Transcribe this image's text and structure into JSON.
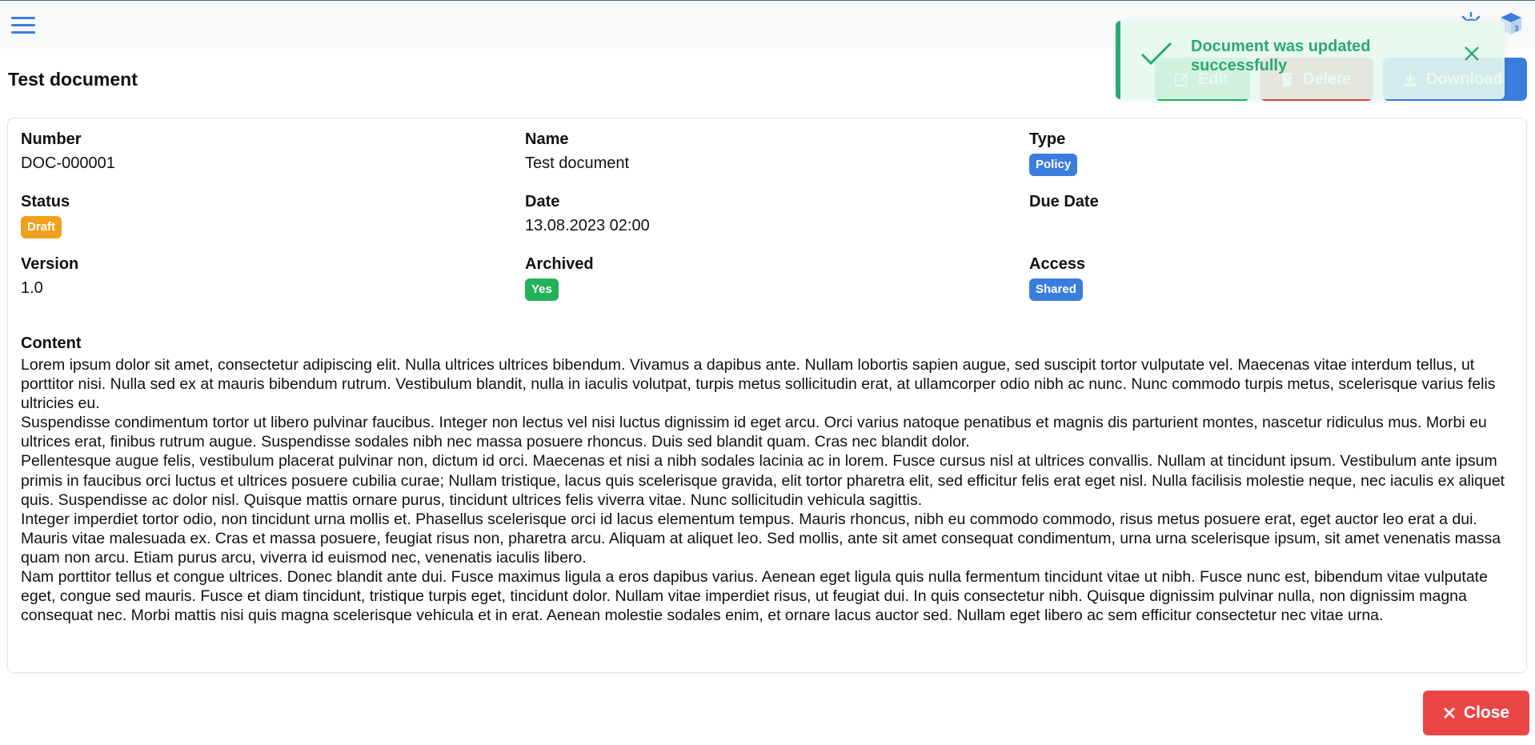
{
  "header": {
    "menu_icon": "hamburger-icon",
    "theme_icon": "sun-icon",
    "app_icon": "cube-icon"
  },
  "page": {
    "title": "Test document"
  },
  "actions": {
    "edit_label": "Edit",
    "delete_label": "Delete",
    "download_label": "Download"
  },
  "toast": {
    "message": "Document was updated successfully",
    "type": "success",
    "color": "#2aa876"
  },
  "fields": {
    "number": {
      "label": "Number",
      "value": "DOC-000001"
    },
    "name": {
      "label": "Name",
      "value": "Test document"
    },
    "type": {
      "label": "Type",
      "value": "Policy",
      "color": "#3b7ddd"
    },
    "status": {
      "label": "Status",
      "value": "Draft",
      "color": "#f0a01e"
    },
    "date": {
      "label": "Date",
      "value": "13.08.2023 02:00"
    },
    "due_date": {
      "label": "Due Date",
      "value": ""
    },
    "version": {
      "label": "Version",
      "value": "1.0"
    },
    "archived": {
      "label": "Archived",
      "value": "Yes",
      "color": "#22b35a"
    },
    "access": {
      "label": "Access",
      "value": "Shared",
      "color": "#3b7ddd"
    }
  },
  "content": {
    "label": "Content",
    "paragraphs": [
      "Lorem ipsum dolor sit amet, consectetur adipiscing elit. Nulla ultrices ultrices bibendum. Vivamus a dapibus ante. Nullam lobortis sapien augue, sed suscipit tortor vulputate vel. Maecenas vitae interdum tellus, ut porttitor nisi. Nulla sed ex at mauris bibendum rutrum. Vestibulum blandit, nulla in iaculis volutpat, turpis metus sollicitudin erat, at ullamcorper odio nibh ac nunc. Nunc commodo turpis metus, scelerisque varius felis ultricies eu.",
      "Suspendisse condimentum tortor ut libero pulvinar faucibus. Integer non lectus vel nisi luctus dignissim id eget arcu. Orci varius natoque penatibus et magnis dis parturient montes, nascetur ridiculus mus. Morbi eu ultrices erat, finibus rutrum augue. Suspendisse sodales nibh nec massa posuere rhoncus. Duis sed blandit quam. Cras nec blandit dolor.",
      "Pellentesque augue felis, vestibulum placerat pulvinar non, dictum id orci. Maecenas et nisi a nibh sodales lacinia ac in lorem. Fusce cursus nisl at ultrices convallis. Nullam at tincidunt ipsum. Vestibulum ante ipsum primis in faucibus orci luctus et ultrices posuere cubilia curae; Nullam tristique, lacus quis scelerisque gravida, elit tortor pharetra elit, sed efficitur felis erat eget nisl. Nulla facilisis molestie neque, nec iaculis ex aliquet quis. Suspendisse ac dolor nisl. Quisque mattis ornare purus, tincidunt ultrices felis viverra vitae. Nunc sollicitudin vehicula sagittis.",
      "Integer imperdiet tortor odio, non tincidunt urna mollis et. Phasellus scelerisque orci id lacus elementum tempus. Mauris rhoncus, nibh eu commodo commodo, risus metus posuere erat, eget auctor leo erat a dui. Mauris vitae malesuada ex. Cras et massa posuere, feugiat risus non, pharetra arcu. Aliquam at aliquet leo. Sed mollis, ante sit amet consequat condimentum, urna urna scelerisque ipsum, sit amet venenatis massa quam non arcu. Etiam purus arcu, viverra id euismod nec, venenatis iaculis libero.",
      "Nam porttitor tellus et congue ultrices. Donec blandit ante dui. Fusce maximus ligula a eros dapibus varius. Aenean eget ligula quis nulla fermentum tincidunt vitae ut nibh. Fusce nunc est, bibendum vitae vulputate eget, congue sed mauris. Fusce et diam tincidunt, tristique turpis eget, tincidunt dolor. Nullam vitae imperdiet risus, ut feugiat dui. In quis consectetur nibh. Quisque dignissim pulvinar nulla, non dignissim magna consequat nec. Morbi mattis nisi quis magna scelerisque vehicula et in erat. Aenean molestie sodales enim, et ornare lacus auctor sed. Nullam eget libero ac sem efficitur consectetur nec vitae urna."
    ]
  },
  "footer": {
    "close_label": "Close"
  }
}
